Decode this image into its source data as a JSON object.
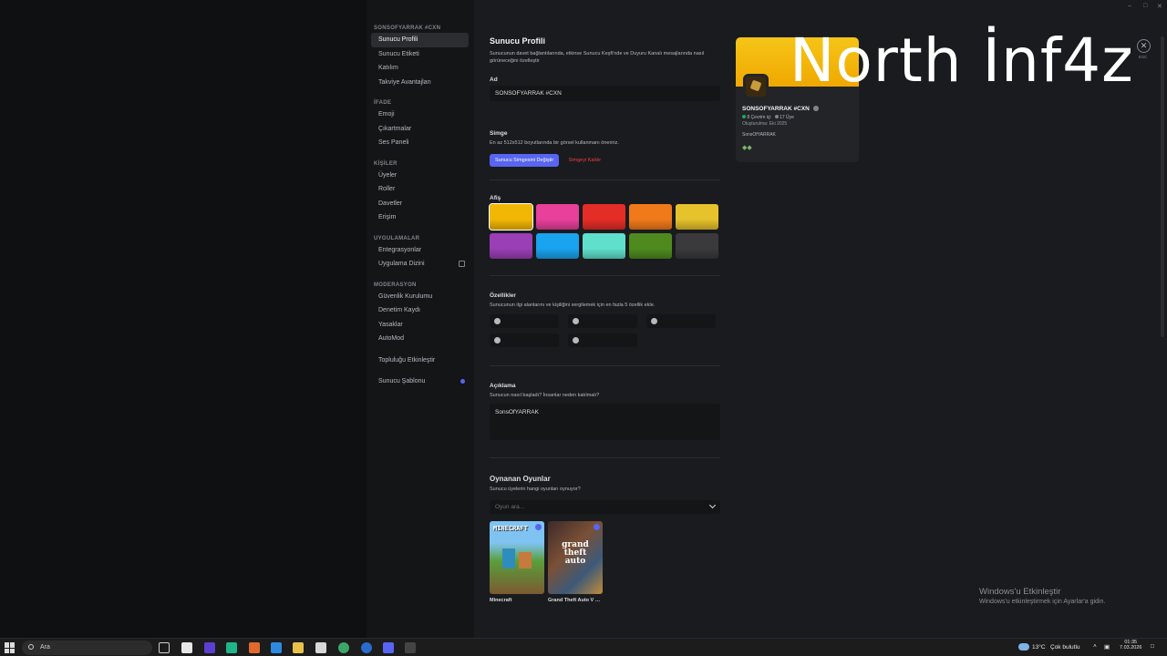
{
  "sidebar": {
    "server_header": "SONSOFYARRAK #CXN",
    "group1": [
      {
        "label": "Sunucu Profili",
        "active": true
      },
      {
        "label": "Sunucu Etiketi"
      },
      {
        "label": "Katılım"
      },
      {
        "label": "Takviye Avantajları"
      }
    ],
    "ifade_title": "İFADE",
    "group2": [
      {
        "label": "Emoji"
      },
      {
        "label": "Çıkartmalar"
      },
      {
        "label": "Ses Paneli"
      }
    ],
    "kisiler_title": "KİŞİLER",
    "group3": [
      {
        "label": "Üyeler"
      },
      {
        "label": "Roller"
      },
      {
        "label": "Davetler"
      },
      {
        "label": "Erişim"
      }
    ],
    "uygulamalar_title": "UYGULAMALAR",
    "group4": [
      {
        "label": "Entegrasyonlar"
      },
      {
        "label": "Uygulama Dizini"
      }
    ],
    "moderasyon_title": "MODERASYON",
    "group5": [
      {
        "label": "Güvenlik Kurulumu"
      },
      {
        "label": "Denetim Kaydı"
      },
      {
        "label": "Yasaklar"
      },
      {
        "label": "AutoMod"
      }
    ],
    "community": "Topluluğu Etkinleştir",
    "template": "Sunucu Şablonu"
  },
  "form": {
    "title": "Sunucu Profili",
    "description": "Sunucunun davet bağlantılarında, etkinse Sunucu Keşfi'nde ve Duyuru Kanalı mesajlarında nasıl görüneceğini özelleştir",
    "name_label": "Ad",
    "name_value": "SONSOFYARRAK #CXN",
    "icon_label": "Simge",
    "icon_desc": "En az 512x512 boyutlarında bir görsel kullanmanı öneririz.",
    "icon_change": "Sunucu Simgesini Değiştir",
    "icon_remove": "Simgeyi Kaldır",
    "banner_label": "Afiş",
    "banner_colors": [
      "#f2b705",
      "#e8409b",
      "#e52d27",
      "#f07a1a",
      "#e6c22c",
      "#9a3fb5",
      "#1aa3ef",
      "#5fe0cc",
      "#4f8a1f",
      "#3a3a3c"
    ],
    "traits_label": "Özellikler",
    "traits_desc": "Sunucunun ilgi alanlarını ve kişiliğini sergilemek için en fazla 5 özellik ekle.",
    "about_label": "Açıklama",
    "about_desc": "Sunucun nasıl başladı? İnsanlar neden katılmalı?",
    "about_value": "SonsOfYARRAK",
    "games_label": "Oynanan Oyunlar",
    "games_desc": "Sunucu üyelerin hangi oyunları oynuyor?",
    "games_placeholder": "Oyun ara...",
    "games": [
      {
        "name": "Minecraft",
        "cover_text": "MINECRAFT"
      },
      {
        "name": "Grand Theft Auto V Leg...",
        "cover_text": "grand theft auto"
      }
    ]
  },
  "preview": {
    "server_name": "SONSOFYARRAK #CXN",
    "online": "8 Çevrim içi",
    "members": "17 Üye",
    "created": "Oluşturulma: Eki 2025",
    "desc": "SonsOfYARRAK"
  },
  "overlay": {
    "watermark": "North İnf4z",
    "close": "✕",
    "esc": "ESC"
  },
  "windows": {
    "activate_title": "Windows'u Etkinleştir",
    "activate_sub": "Windows'u etkinleştirmek için Ayarlar'a gidin."
  },
  "taskbar": {
    "search_placeholder": "Ara",
    "weather": "13°C",
    "weather_desc": "Çok bulutlu",
    "time": "01:35",
    "date": "7.03.2026"
  }
}
